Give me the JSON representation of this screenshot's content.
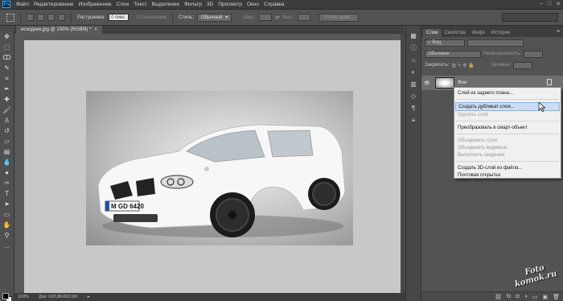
{
  "app": {
    "logo": "Ps"
  },
  "menu": [
    "Файл",
    "Редактирование",
    "Изображение",
    "Слои",
    "Текст",
    "Выделение",
    "Фильтр",
    "3D",
    "Просмотр",
    "Окно",
    "Справка"
  ],
  "options": {
    "feather_label": "Растушевка:",
    "feather_value": "0 пикс.",
    "antialias_label": "Сглаживание",
    "style_label": "Стиль:",
    "style_value": "Обычный",
    "width_label": "Шир.:",
    "height_label": "Выс.:",
    "refine_button": "Уточн. край..."
  },
  "document": {
    "tab_title": "исходник.jpg @ 100% (RGB/8) *",
    "status_zoom": "100%",
    "status_doc": "Док: 693,8K/693,8K"
  },
  "layers_panel": {
    "tabs": [
      "Слои",
      "Свойства",
      "Инфо",
      "История"
    ],
    "kind_value": "Вид",
    "blend_mode": "Обычные",
    "opacity_label": "Непрозрачность:",
    "lock_label": "Закрепить:",
    "fill_label": "Заливка:",
    "layer_name": "Фон"
  },
  "context_menu": {
    "items": [
      {
        "label": "Слой из заднего плана...",
        "disabled": false
      },
      {
        "label": "Создать дубликат слоя...",
        "disabled": false,
        "hover": true
      },
      {
        "label": "Удалить слой",
        "disabled": true
      },
      {
        "label": "Преобразовать в смарт-объект",
        "disabled": false
      },
      {
        "label": "Объединить слои",
        "disabled": true
      },
      {
        "label": "Объединить видимые",
        "disabled": true
      },
      {
        "label": "Выполнить сведение",
        "disabled": true
      },
      {
        "label": "Создать 3D-слой из файла...",
        "disabled": false
      },
      {
        "label": "Почтовая открытка",
        "disabled": false
      }
    ]
  },
  "photo": {
    "plate": "M GD 6420"
  },
  "watermark": {
    "line1": "Foto",
    "line2": "komok.ru"
  },
  "colors": {
    "accent": "#31a8ff",
    "highlight": "#c9ddf4"
  }
}
